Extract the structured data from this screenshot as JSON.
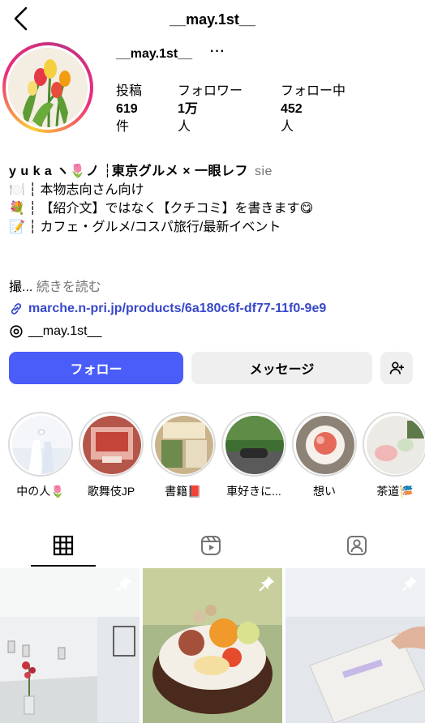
{
  "header": {
    "title": "__may.1st__",
    "back_icon": "chevron-left-icon"
  },
  "profile": {
    "username": "__may.1st__",
    "more_label": "···",
    "stats": {
      "posts_label": "投稿",
      "posts_value": "619",
      "posts_unit": "件",
      "followers_label": "フォロワー",
      "followers_value": "1万",
      "followers_unit": "人",
      "following_label": "フォロー中",
      "following_value": "452",
      "following_unit": "人"
    }
  },
  "bio": {
    "name": "y u k a ヽ🌷ノ ┆東京グルメ × 一眼レフ",
    "pronoun": "sie",
    "lines": [
      "🍽️ ┆ 本物志向さん向け",
      "💐 ┆ 【紹介文】ではなく【クチコミ】を書きます😋",
      "📝 ┆ カフェ・グルメ/コスパ旅行/最新イベント"
    ],
    "truncated_text": "撮...",
    "read_more": "続きを読む"
  },
  "link": {
    "text": "marche.n-pri.jp/products/6a180c6f-df77-11f0-9e9"
  },
  "threads": {
    "text": "__may.1st__"
  },
  "actions": {
    "follow": "フォロー",
    "message": "メッセージ"
  },
  "highlights": [
    {
      "label": "中の人🌷"
    },
    {
      "label": "歌舞伎JP"
    },
    {
      "label": "書籍📕"
    },
    {
      "label": "車好きに..."
    },
    {
      "label": "想い"
    },
    {
      "label": "茶道🎏"
    }
  ],
  "tabs": [
    "grid-icon",
    "reels-icon",
    "tagged-icon"
  ],
  "colors": {
    "follow": "#4a5df9",
    "link": "#3848c9",
    "secondary_text": "#737373"
  }
}
